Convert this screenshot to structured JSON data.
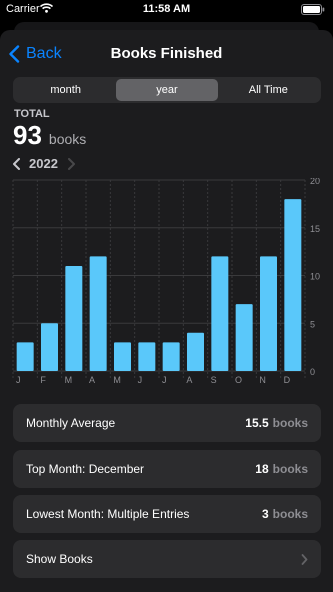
{
  "status_bar": {
    "carrier": "Carrier",
    "time": "11:58 AM"
  },
  "nav": {
    "back_label": "Back",
    "title": "Books Finished"
  },
  "segments": [
    {
      "label": "month",
      "active": false
    },
    {
      "label": "year",
      "active": true
    },
    {
      "label": "All Time",
      "active": false
    }
  ],
  "summary": {
    "total_label": "TOTAL",
    "total_value": "93",
    "total_unit": "books",
    "year": "2022"
  },
  "chart_data": {
    "type": "bar",
    "categories": [
      "J",
      "F",
      "M",
      "A",
      "M",
      "J",
      "J",
      "A",
      "S",
      "O",
      "N",
      "D"
    ],
    "values": [
      3,
      5,
      11,
      12,
      3,
      3,
      3,
      4,
      12,
      7,
      12,
      18
    ],
    "ylim": [
      0,
      20
    ],
    "yticks": [
      0,
      5,
      10,
      15,
      20
    ],
    "y_axis_side": "right",
    "grid": true,
    "bar_color": "#5ac8fa"
  },
  "stats": [
    {
      "label": "Monthly Average",
      "value": "15.5",
      "unit": "books"
    },
    {
      "label": "Top Month: December",
      "value": "18",
      "unit": "books"
    },
    {
      "label": "Lowest Month: Multiple Entries",
      "value": "3",
      "unit": "books"
    }
  ],
  "show_books": {
    "label": "Show Books"
  },
  "colors": {
    "accent": "#0a84ff",
    "background": "#1c1c1e",
    "card": "#2c2c2e"
  }
}
